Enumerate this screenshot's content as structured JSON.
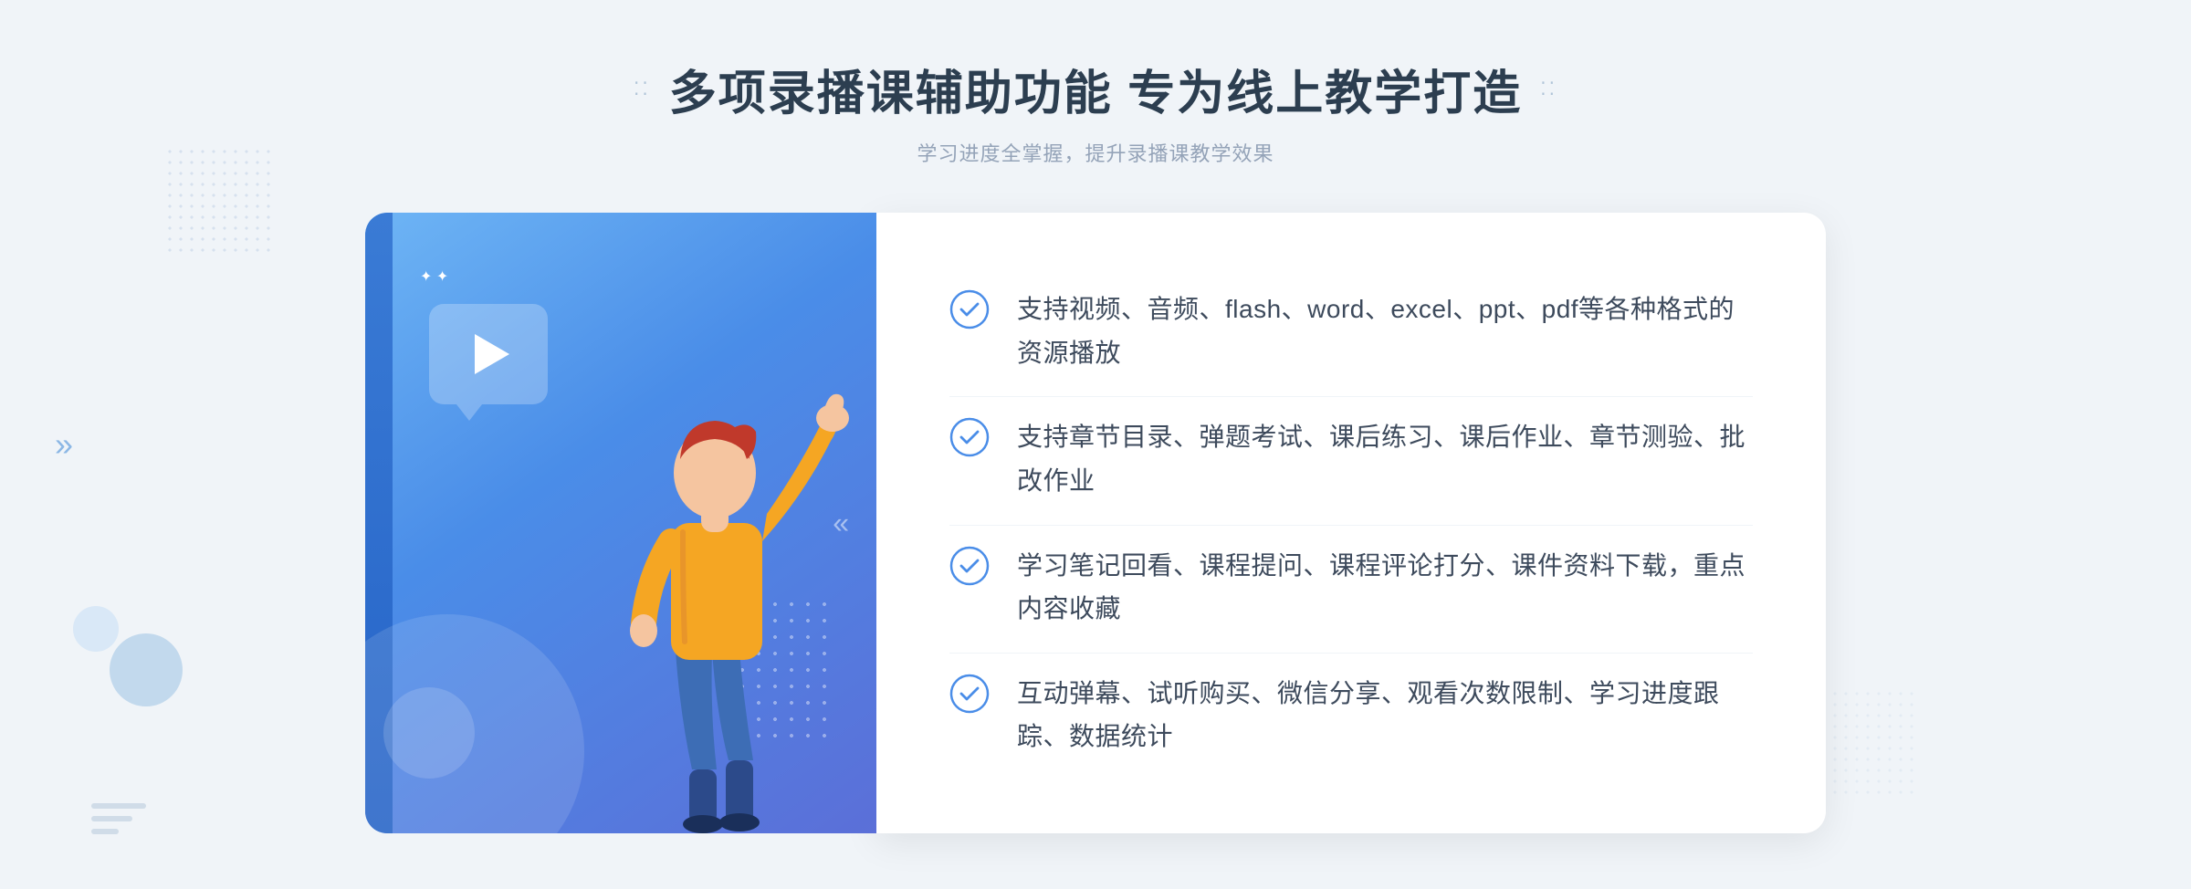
{
  "header": {
    "title": "多项录播课辅助功能 专为线上教学打造",
    "subtitle": "学习进度全掌握，提升录播课教学效果",
    "dots_left": "⁚⁚",
    "dots_right": "⁚⁚"
  },
  "features": [
    {
      "id": 1,
      "text": "支持视频、音频、flash、word、excel、ppt、pdf等各种格式的资源播放"
    },
    {
      "id": 2,
      "text": "支持章节目录、弹题考试、课后练习、课后作业、章节测验、批改作业"
    },
    {
      "id": 3,
      "text": "学习笔记回看、课程提问、课程评论打分、课件资料下载，重点内容收藏"
    },
    {
      "id": 4,
      "text": "互动弹幕、试听购买、微信分享、观看次数限制、学习进度跟踪、数据统计"
    }
  ],
  "colors": {
    "accent_blue": "#4a8de8",
    "text_dark": "#2c3e50",
    "text_medium": "#3d4a5c",
    "text_light": "#94a3b8",
    "check_color": "#4a8de8"
  }
}
